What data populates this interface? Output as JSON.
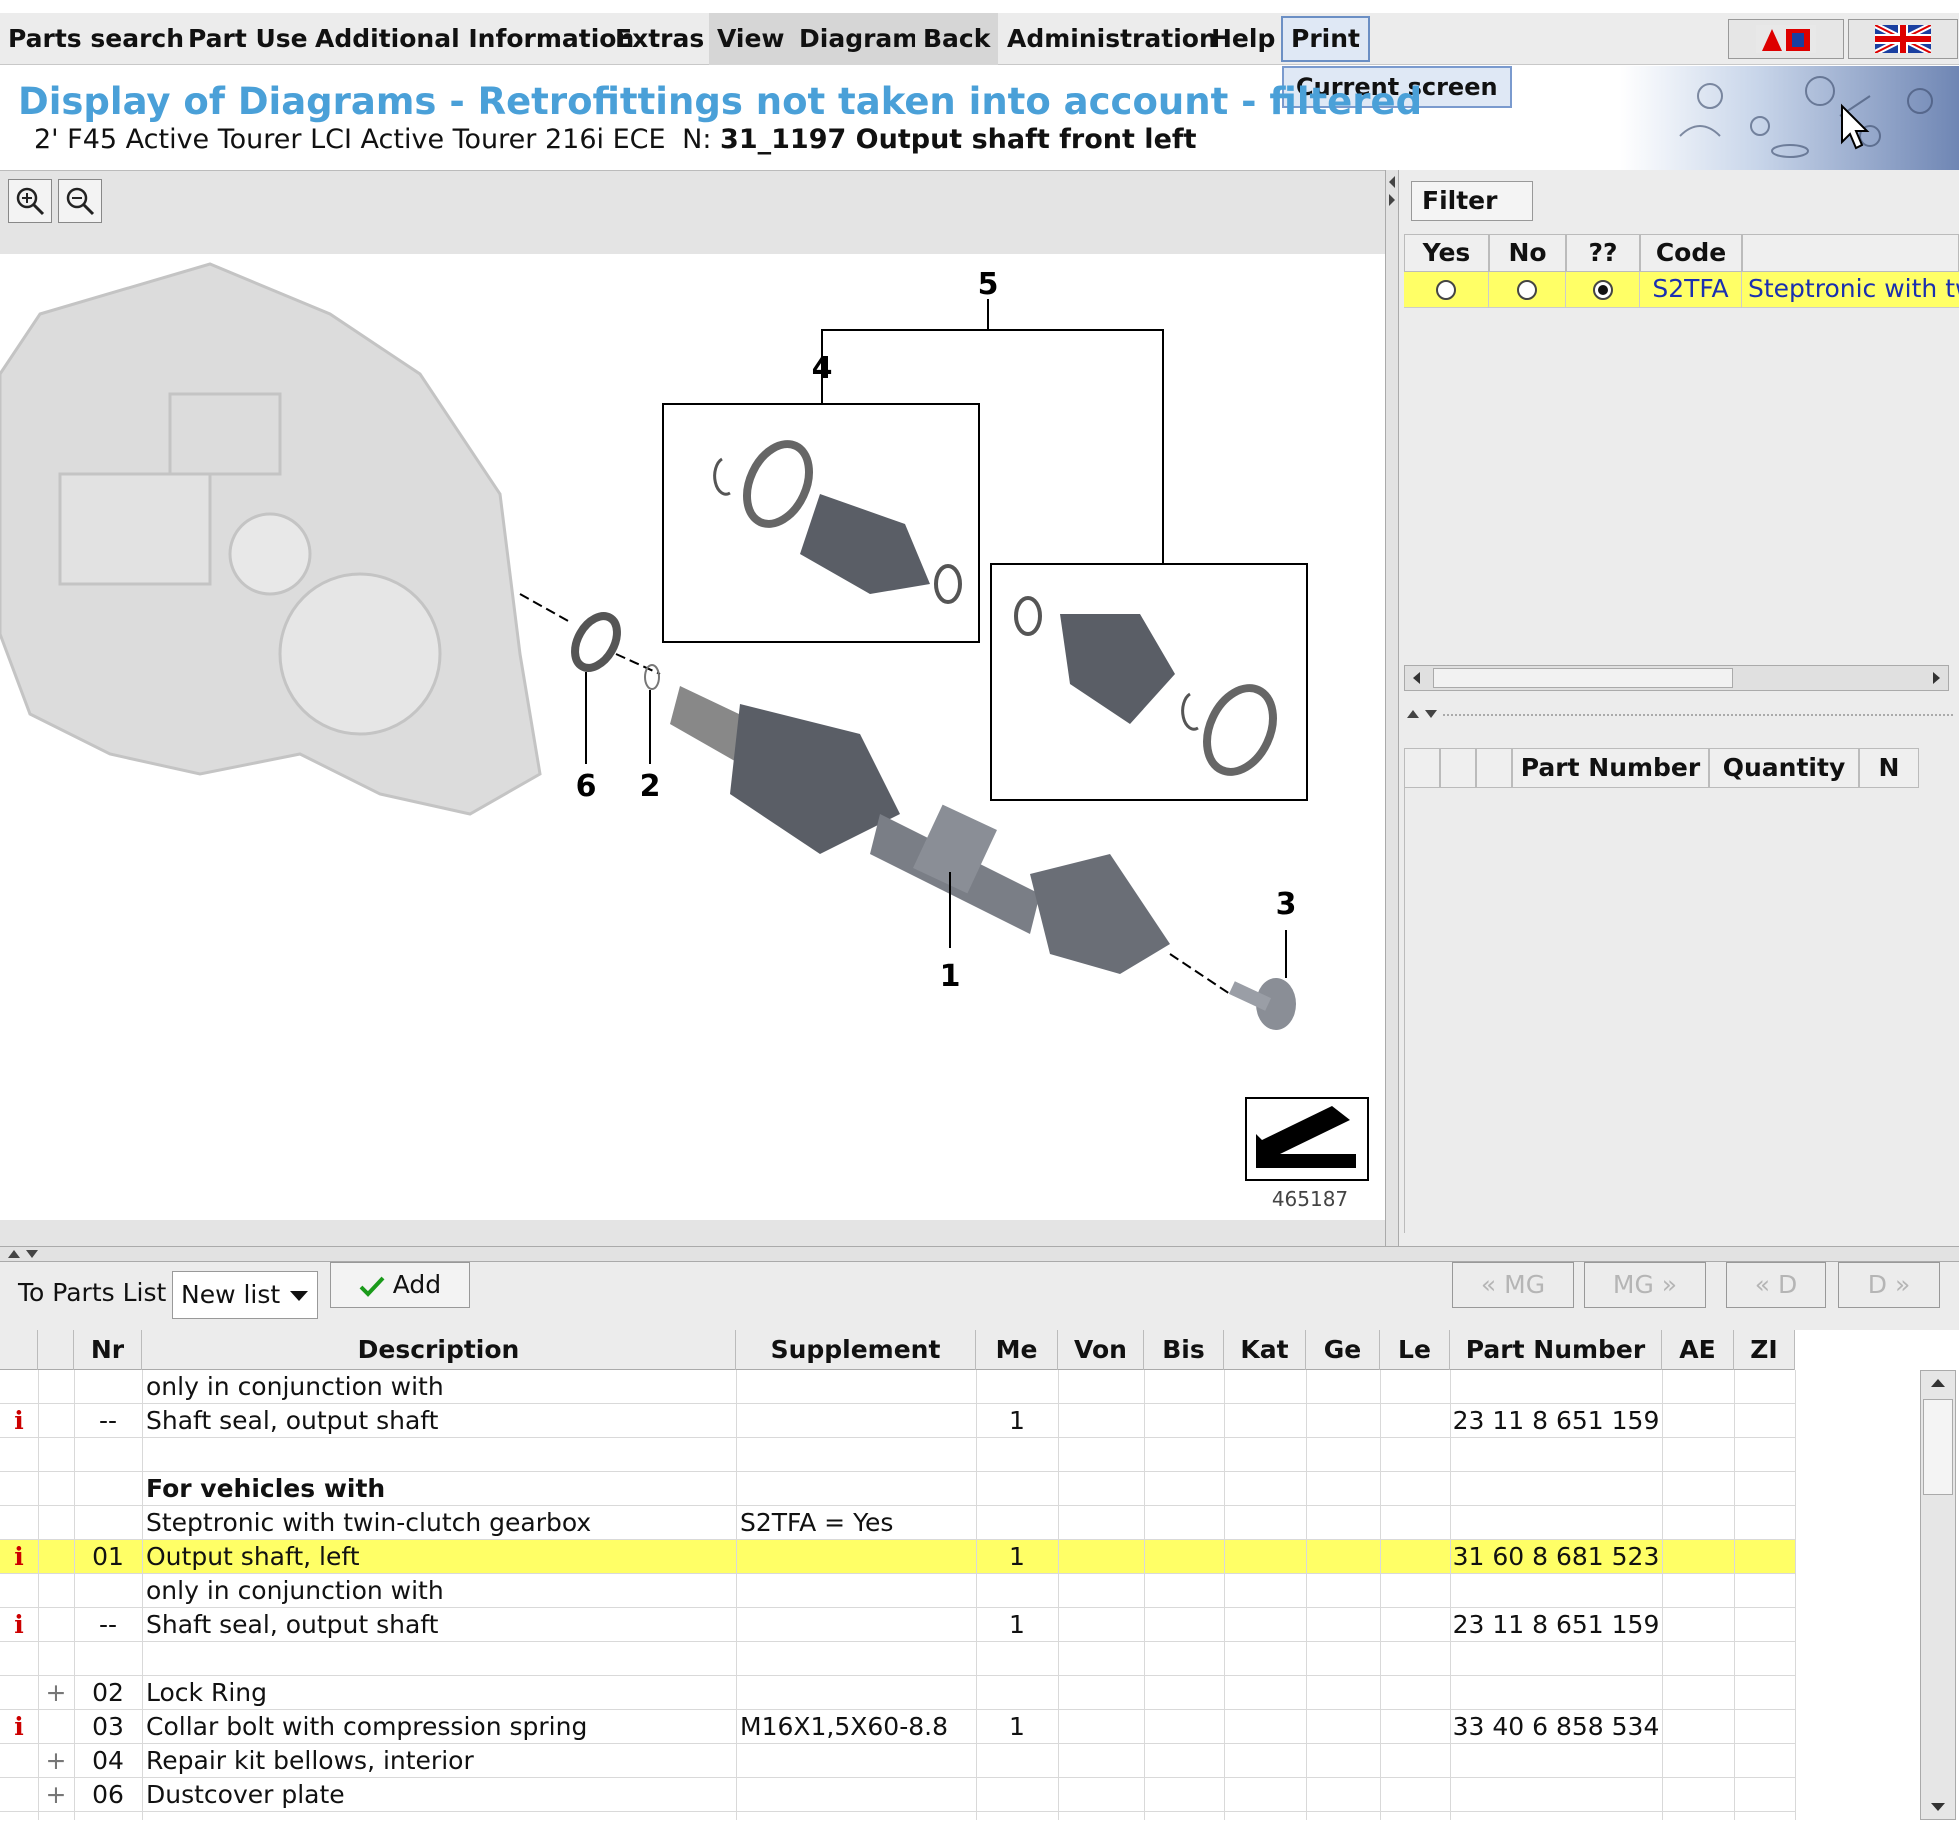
{
  "menu": {
    "items": [
      "Parts search",
      "Part Use",
      "Additional Information",
      "Extras",
      "View",
      "Diagram",
      "Back",
      "Administration",
      "Help",
      "Print"
    ],
    "dropdown_item": "Current screen"
  },
  "header": {
    "title": "Display of Diagrams - Retrofittings not taken into account - filtered",
    "vehicle": "2' F45 Active Tourer LCI Active Tourer 216i ECE",
    "n_label": "N:",
    "diagram_name": "31_1197 Output shaft front left"
  },
  "diagram": {
    "callouts": [
      "1",
      "2",
      "3",
      "4",
      "5",
      "6"
    ],
    "image_number": "465187"
  },
  "filter": {
    "button_label": "Filter",
    "columns": [
      "Yes",
      "No",
      "??",
      "Code"
    ],
    "row": {
      "code": "S2TFA",
      "description": "Steptronic with twin-clutch gearbox",
      "selected": "??"
    }
  },
  "partnumber_panel": {
    "columns": [
      "Part Number",
      "Quantity",
      "N"
    ]
  },
  "parts_toolbar": {
    "label": "To Parts List",
    "select_value": "New list",
    "add_label": "Add",
    "nav": [
      "« MG",
      "MG »",
      "« D",
      "D »"
    ]
  },
  "grid": {
    "columns": [
      "Nr",
      "Description",
      "Supplement",
      "Me",
      "Von",
      "Bis",
      "Kat",
      "Ge",
      "Le",
      "Part Number",
      "AE",
      "ZI"
    ],
    "rows": [
      {
        "info": "",
        "plus": "",
        "nr": "",
        "desc": "only in conjunction with",
        "supp": "",
        "me": "",
        "pn": "",
        "bold": false,
        "hl": false
      },
      {
        "info": "i",
        "plus": "",
        "nr": "--",
        "desc": "Shaft seal, output shaft",
        "supp": "",
        "me": "1",
        "pn": "23 11 8 651 159",
        "bold": false,
        "hl": false
      },
      {
        "info": "",
        "plus": "",
        "nr": "",
        "desc": "",
        "supp": "",
        "me": "",
        "pn": "",
        "bold": false,
        "hl": false
      },
      {
        "info": "",
        "plus": "",
        "nr": "",
        "desc": "For vehicles with",
        "supp": "",
        "me": "",
        "pn": "",
        "bold": true,
        "hl": false
      },
      {
        "info": "",
        "plus": "",
        "nr": "",
        "desc": "Steptronic with twin-clutch gearbox",
        "supp": "S2TFA = Yes",
        "me": "",
        "pn": "",
        "bold": false,
        "hl": false
      },
      {
        "info": "i",
        "plus": "",
        "nr": "01",
        "desc": "Output shaft, left",
        "supp": "",
        "me": "1",
        "pn": "31 60 8 681 523",
        "bold": false,
        "hl": true
      },
      {
        "info": "",
        "plus": "",
        "nr": "",
        "desc": "only in conjunction with",
        "supp": "",
        "me": "",
        "pn": "",
        "bold": false,
        "hl": false
      },
      {
        "info": "i",
        "plus": "",
        "nr": "--",
        "desc": "Shaft seal, output shaft",
        "supp": "",
        "me": "1",
        "pn": "23 11 8 651 159",
        "bold": false,
        "hl": false
      },
      {
        "info": "",
        "plus": "",
        "nr": "",
        "desc": "",
        "supp": "",
        "me": "",
        "pn": "",
        "bold": false,
        "hl": false
      },
      {
        "info": "",
        "plus": "+",
        "nr": "02",
        "desc": "Lock Ring",
        "supp": "",
        "me": "",
        "pn": "",
        "bold": false,
        "hl": false
      },
      {
        "info": "i",
        "plus": "",
        "nr": "03",
        "desc": "Collar bolt with compression spring",
        "supp": "M16X1,5X60-8.8",
        "me": "1",
        "pn": "33 40 6 858 534",
        "bold": false,
        "hl": false
      },
      {
        "info": "",
        "plus": "+",
        "nr": "04",
        "desc": "Repair kit bellows, interior",
        "supp": "",
        "me": "",
        "pn": "",
        "bold": false,
        "hl": false
      },
      {
        "info": "",
        "plus": "+",
        "nr": "06",
        "desc": "Dustcover plate",
        "supp": "",
        "me": "",
        "pn": "",
        "bold": false,
        "hl": false
      }
    ]
  }
}
